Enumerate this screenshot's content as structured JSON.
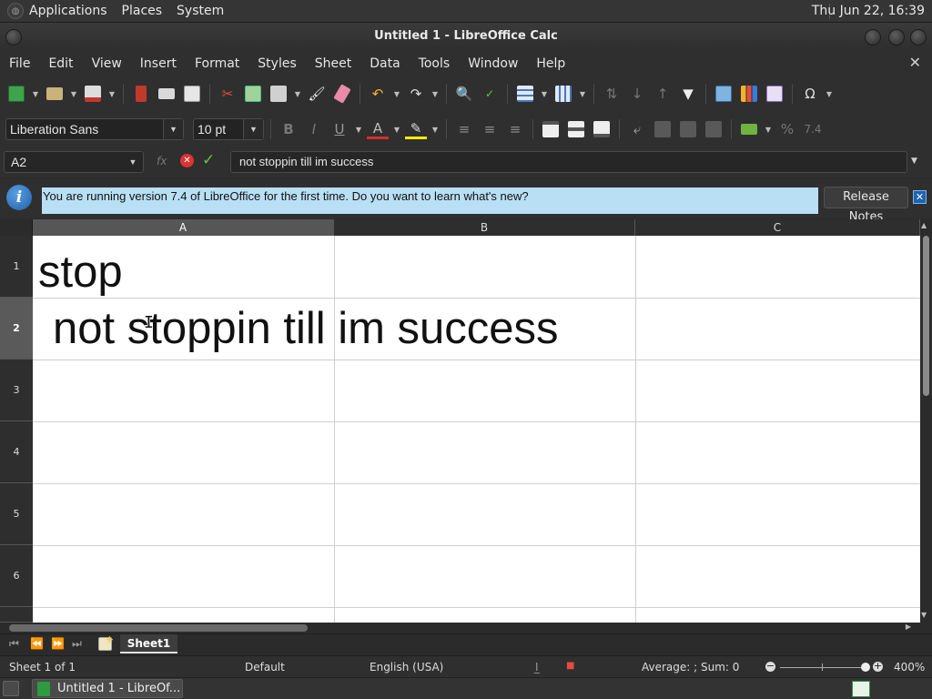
{
  "top_panel": {
    "menus": [
      "Applications",
      "Places",
      "System"
    ],
    "clock": "Thu Jun 22, 16:39"
  },
  "window": {
    "title": "Untitled 1 - LibreOffice Calc"
  },
  "menubar": [
    "File",
    "Edit",
    "View",
    "Insert",
    "Format",
    "Styles",
    "Sheet",
    "Data",
    "Tools",
    "Window",
    "Help"
  ],
  "toolbar": {
    "font_name": "Liberation Sans",
    "font_size": "10 pt"
  },
  "formula_bar": {
    "name_box": "A2",
    "content": "not stoppin till im success"
  },
  "infobar": {
    "message": "You are running version 7.4 of LibreOffice for the first time. Do you want to learn what's new?",
    "button_label": "Release Notes"
  },
  "grid": {
    "columns": [
      "A",
      "B",
      "C"
    ],
    "rows": [
      "1",
      "2",
      "3",
      "4",
      "5",
      "6"
    ],
    "selected_cell": "A2",
    "cells": {
      "A1": "stop",
      "A2": "not stoppin till im success"
    }
  },
  "sheet_tabs": [
    "Sheet1"
  ],
  "statusbar": {
    "sheet_info": "Sheet 1 of 1",
    "page_style": "Default",
    "language": "English (USA)",
    "sum_info": "Average: ; Sum: 0",
    "zoom": "400%"
  },
  "taskbar": {
    "window_button": "Untitled 1 - LibreOf..."
  },
  "colors": {
    "infobar_bg": "#b9dff5",
    "accept": "#5fc34a",
    "cancel": "#dd3333",
    "calc_green": "#2d9b3e"
  }
}
